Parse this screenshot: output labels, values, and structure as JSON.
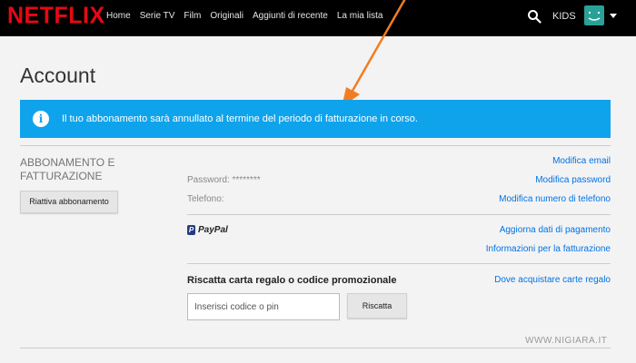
{
  "brand": {
    "logo": "NETFLIX",
    "logo_color": "#e50914"
  },
  "nav": {
    "items": [
      "Home",
      "Serie TV",
      "Film",
      "Originali",
      "Aggiunti di recente",
      "La mia lista"
    ],
    "kids": "KIDS"
  },
  "page": {
    "title": "Account"
  },
  "alert": {
    "text": "Il tuo abbonamento sarà annullato al termine del periodo di fatturazione in corso.",
    "icon": "i",
    "color": "#0fa3ec"
  },
  "membership": {
    "section_title": "ABBONAMENTO E FATTURAZIONE",
    "reactivate_label": "Riattiva abbonamento",
    "password_label": "Password:",
    "password_value": "********",
    "phone_label": "Telefono:",
    "links": {
      "change_email": "Modifica email",
      "change_password": "Modifica password",
      "change_phone": "Modifica numero di telefono",
      "update_payment": "Aggiorna dati di pagamento",
      "billing_details": "Informazioni per la fatturazione",
      "where_to_buy": "Dove acquistare carte regalo"
    },
    "payment_method": "PayPal"
  },
  "promo": {
    "title": "Riscatta carta regalo o codice promozionale",
    "placeholder": "Inserisci codice o pin",
    "redeem_label": "Riscatta"
  },
  "watermark": "WWW.NIGIARA.IT",
  "annotation": {
    "arrow_color": "#f47c20"
  }
}
